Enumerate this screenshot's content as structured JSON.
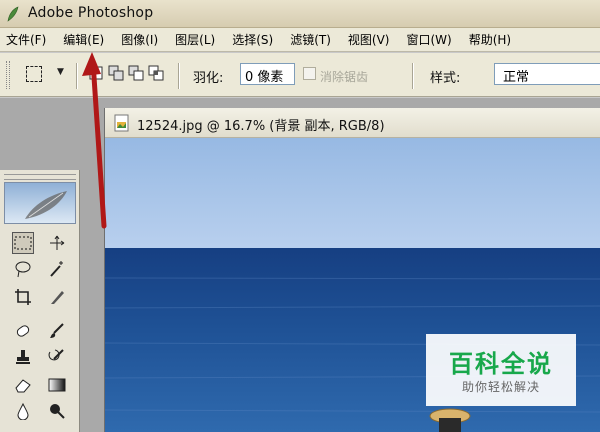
{
  "app": {
    "title": "Adobe Photoshop",
    "icon": "photoshop-feather-icon"
  },
  "menu": {
    "items": [
      {
        "label": "文件(F)"
      },
      {
        "label": "编辑(E)"
      },
      {
        "label": "图像(I)"
      },
      {
        "label": "图层(L)"
      },
      {
        "label": "选择(S)"
      },
      {
        "label": "滤镜(T)"
      },
      {
        "label": "视图(V)"
      },
      {
        "label": "窗口(W)"
      },
      {
        "label": "帮助(H)"
      }
    ],
    "highlighted": "编辑(E)"
  },
  "options_bar": {
    "feather_label": "羽化:",
    "feather_value": "0 像素",
    "antialias_label": "消除锯齿",
    "antialias_checked": false,
    "style_label": "样式:",
    "style_value": "正常"
  },
  "document": {
    "title": "12524.jpg @ 16.7% (背景 副本, RGB/8)"
  },
  "toolbox": {
    "tools": [
      "rectangular-marquee-icon",
      "move-icon",
      "lasso-icon",
      "magic-wand-icon",
      "crop-icon",
      "slice-icon",
      "healing-brush-icon",
      "brush-icon",
      "clone-stamp-icon",
      "history-brush-icon",
      "eraser-icon",
      "gradient-icon",
      "blur-icon",
      "dodge-icon"
    ]
  },
  "watermark": {
    "title": "百科全说",
    "subtitle": "助你轻松解决"
  },
  "colors": {
    "annotation_arrow": "#b01818",
    "sea": "#1f4f8f",
    "sky": "#a9c3e6",
    "watermark_green": "#18a84b"
  }
}
